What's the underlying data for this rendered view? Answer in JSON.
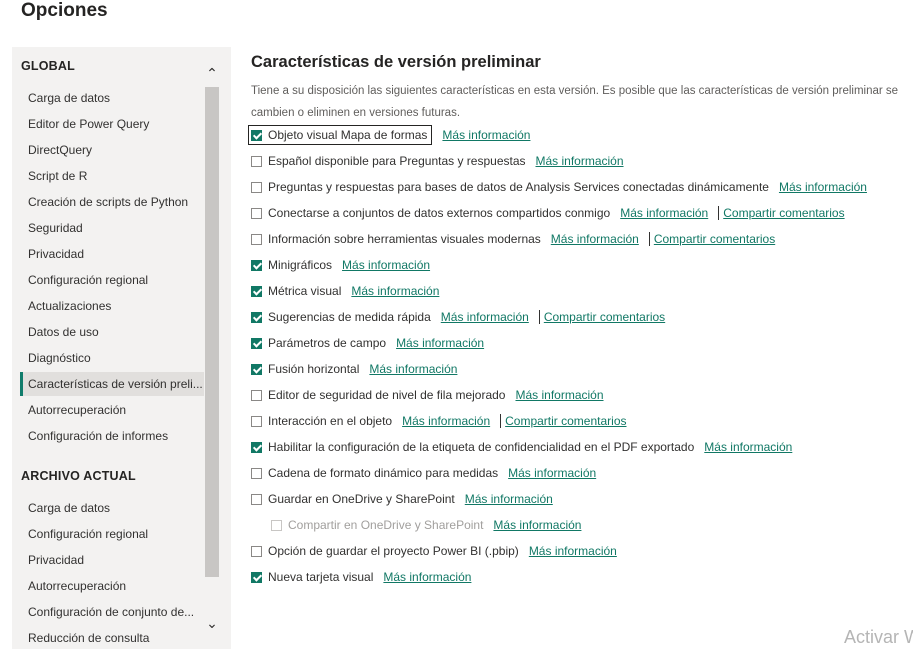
{
  "window": {
    "title": "Opciones"
  },
  "sidebar": {
    "global_header": "GLOBAL",
    "global_items": [
      {
        "label": "Carga de datos"
      },
      {
        "label": "Editor de Power Query"
      },
      {
        "label": "DirectQuery"
      },
      {
        "label": "Script de R"
      },
      {
        "label": "Creación de scripts de Python"
      },
      {
        "label": "Seguridad"
      },
      {
        "label": "Privacidad"
      },
      {
        "label": "Configuración regional"
      },
      {
        "label": "Actualizaciones"
      },
      {
        "label": "Datos de uso"
      },
      {
        "label": "Diagnóstico"
      },
      {
        "label": "Características de versión preli..."
      },
      {
        "label": "Autorrecuperación"
      },
      {
        "label": "Configuración de informes"
      }
    ],
    "current_header": "ARCHIVO ACTUAL",
    "current_items": [
      {
        "label": "Carga de datos"
      },
      {
        "label": "Configuración regional"
      },
      {
        "label": "Privacidad"
      },
      {
        "label": "Autorrecuperación"
      },
      {
        "label": "Configuración de conjunto de..."
      },
      {
        "label": "Reducción de consulta"
      }
    ],
    "active_item": "Características de versión preli..."
  },
  "main": {
    "title": "Características de versión preliminar",
    "description": "Tiene a su disposición las siguientes características en esta versión. Es posible que las características de versión preliminar se cambien o eliminen en versiones futuras.",
    "features": [
      {
        "label": "Objeto visual Mapa de formas",
        "checked": true,
        "link": "Más información"
      },
      {
        "label": "Español disponible para Preguntas y respuestas",
        "checked": false,
        "link": "Más información"
      },
      {
        "label": "Preguntas y respuestas para bases de datos de Analysis Services conectadas dinámicamente",
        "checked": false,
        "link": "Más información"
      },
      {
        "label": "Conectarse a conjuntos de datos externos compartidos conmigo",
        "checked": false,
        "link": "Más información",
        "feedback": "Compartir comentarios"
      },
      {
        "label": "Información sobre herramientas visuales modernas",
        "checked": false,
        "link": "Más información",
        "feedback": "Compartir comentarios"
      },
      {
        "label": "Minigráficos",
        "checked": true,
        "link": "Más información"
      },
      {
        "label": "Métrica visual",
        "checked": true,
        "link": "Más información"
      },
      {
        "label": "Sugerencias de medida rápida",
        "checked": true,
        "link": "Más información",
        "feedback": "Compartir comentarios"
      },
      {
        "label": "Parámetros de campo",
        "checked": true,
        "link": "Más información"
      },
      {
        "label": "Fusión horizontal",
        "checked": true,
        "link": "Más información"
      },
      {
        "label": "Editor de seguridad de nivel de fila mejorado",
        "checked": false,
        "link": "Más información"
      },
      {
        "label": "Interacción en el objeto",
        "checked": false,
        "link": "Más información",
        "feedback": "Compartir comentarios"
      },
      {
        "label": "Habilitar la configuración de la etiqueta de confidencialidad en el PDF exportado",
        "checked": true,
        "link": "Más información"
      },
      {
        "label": "Cadena de formato dinámico para medidas",
        "checked": false,
        "link": "Más información"
      },
      {
        "label": "Guardar en OneDrive y SharePoint",
        "checked": false,
        "link": "Más información"
      },
      {
        "label": "Compartir en OneDrive y SharePoint",
        "checked": false,
        "disabled": true,
        "indent": true,
        "link": "Más información"
      },
      {
        "label": "Opción de guardar el proyecto Power BI (.pbip)",
        "checked": false,
        "link": "Más información"
      },
      {
        "label": "Nueva tarjeta visual",
        "checked": true,
        "link": "Más información"
      }
    ]
  },
  "watermark": "Activar W",
  "colors": {
    "accent": "#117865",
    "sidebar_bg": "#f3f2f1",
    "active_bg": "#e1dfdd"
  }
}
